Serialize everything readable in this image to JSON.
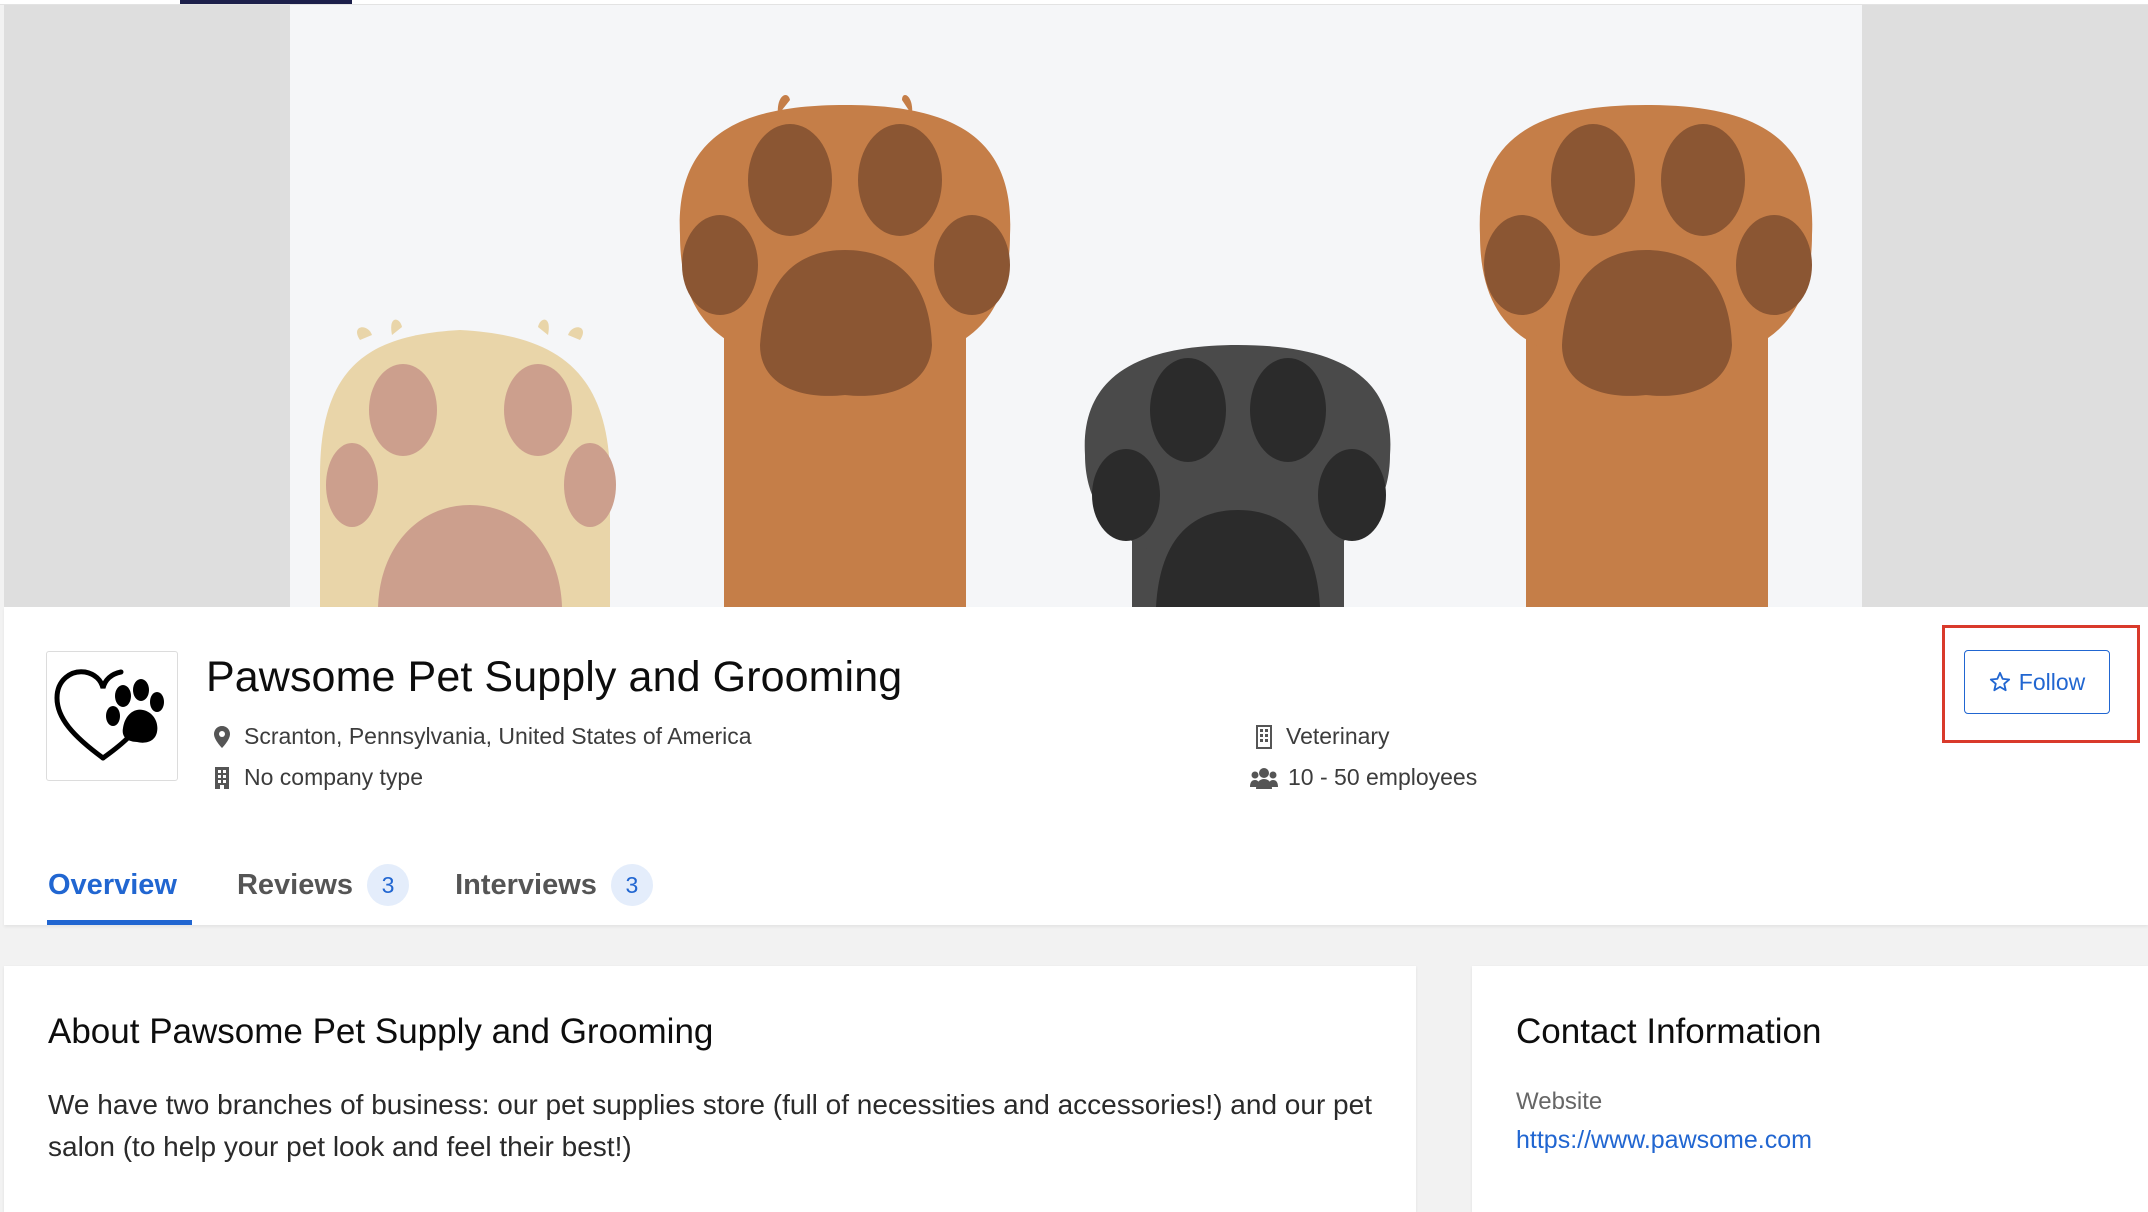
{
  "colors": {
    "accent": "#2166d1",
    "highlight": "#d93a2b",
    "paw_cream": "#e9d5a9",
    "paw_cream_pad": "#cc9f8d",
    "paw_orange": "#c57e48",
    "paw_orange_pad": "#8b5633",
    "paw_gray": "#4a4a4a",
    "paw_gray_pad": "#2b2b2b"
  },
  "company": {
    "name": "Pawsome Pet Supply and Grooming",
    "logo_icon": "heart-paw-logo",
    "location": "Scranton, Pennsylvania, United States of America",
    "location_icon": "map-pin-icon",
    "company_type": "No company type",
    "company_type_icon": "building-icon",
    "industry": "Veterinary",
    "industry_icon": "building-icon",
    "size": "10 - 50 employees",
    "size_icon": "users-icon"
  },
  "follow": {
    "label": "Follow",
    "icon": "star-icon"
  },
  "tabs": [
    {
      "label": "Overview",
      "active": true
    },
    {
      "label": "Reviews",
      "count": "3"
    },
    {
      "label": "Interviews",
      "count": "3"
    }
  ],
  "about": {
    "title": "About Pawsome Pet Supply and Grooming",
    "text": "We have two branches of business: our pet supplies store (full of necessities and accessories!) and our pet salon (to help your pet look and feel their best!)"
  },
  "contact": {
    "title": "Contact Information",
    "website_label": "Website",
    "website_url": "https://www.pawsome.com"
  }
}
